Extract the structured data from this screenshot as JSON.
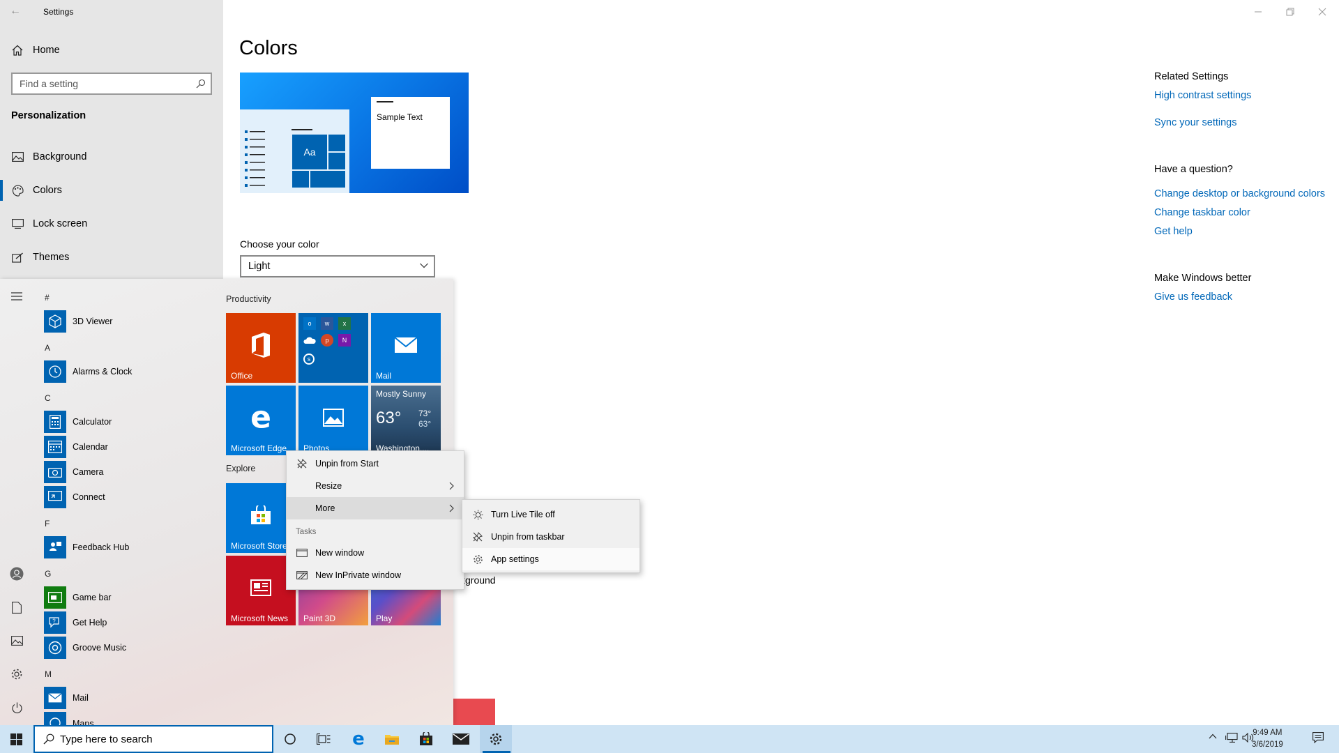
{
  "window": {
    "title": "Settings",
    "back_label": "←"
  },
  "nav": {
    "home": "Home",
    "search_placeholder": "Find a setting",
    "section": "Personalization",
    "items": [
      {
        "label": "Background",
        "icon": "image-icon"
      },
      {
        "label": "Colors",
        "icon": "palette-icon"
      },
      {
        "label": "Lock screen",
        "icon": "lock-screen-icon"
      },
      {
        "label": "Themes",
        "icon": "brush-icon"
      }
    ]
  },
  "content": {
    "title": "Colors",
    "preview_sample": "Sample Text",
    "preview_tile": "Aa",
    "choose_label": "Choose your color",
    "choose_value": "Light",
    "background_fragment": "kground"
  },
  "related": {
    "heading": "Related Settings",
    "links": [
      "High contrast settings",
      "Sync your settings"
    ],
    "question_heading": "Have a question?",
    "question_links": [
      "Change desktop or background colors",
      "Change taskbar color",
      "Get help"
    ],
    "better_heading": "Make Windows better",
    "better_link": "Give us feedback"
  },
  "start": {
    "letters": {
      "hash": "#",
      "a": "A",
      "c": "C",
      "f": "F",
      "g": "G",
      "m": "M"
    },
    "apps": {
      "viewer": "3D Viewer",
      "alarms": "Alarms & Clock",
      "calculator": "Calculator",
      "calendar": "Calendar",
      "camera": "Camera",
      "connect": "Connect",
      "feedback": "Feedback Hub",
      "gamebar": "Game bar",
      "gethelp": "Get Help",
      "groove": "Groove Music",
      "mail": "Mail",
      "maps": "Maps"
    },
    "groups": {
      "productivity": "Productivity",
      "explore": "Explore"
    },
    "tiles": {
      "office": "Office",
      "mail": "Mail",
      "edge": "Microsoft Edge",
      "photos": "Photos",
      "weather_cond": "Mostly Sunny",
      "weather_temp": "63°",
      "weather_hi": "73°",
      "weather_lo": "63°",
      "weather_city": "Washington,...",
      "store": "Microsoft Store",
      "news": "Microsoft News",
      "paint3d": "Paint 3D",
      "play": "Play"
    }
  },
  "context_menu": {
    "unpin": "Unpin from Start",
    "resize": "Resize",
    "more": "More",
    "tasks_header": "Tasks",
    "new_window": "New window",
    "new_private": "New InPrivate window"
  },
  "submenu": {
    "live_tile": "Turn Live Tile off",
    "unpin_taskbar": "Unpin from taskbar",
    "app_settings": "App settings"
  },
  "taskbar": {
    "search_placeholder": "Type here to search",
    "time": "9:49 AM",
    "date": "3/6/2019"
  },
  "colors": {
    "accent": "#0063b1",
    "link": "#0067b8",
    "office": "#d83b01",
    "news": "#c50f1f"
  }
}
